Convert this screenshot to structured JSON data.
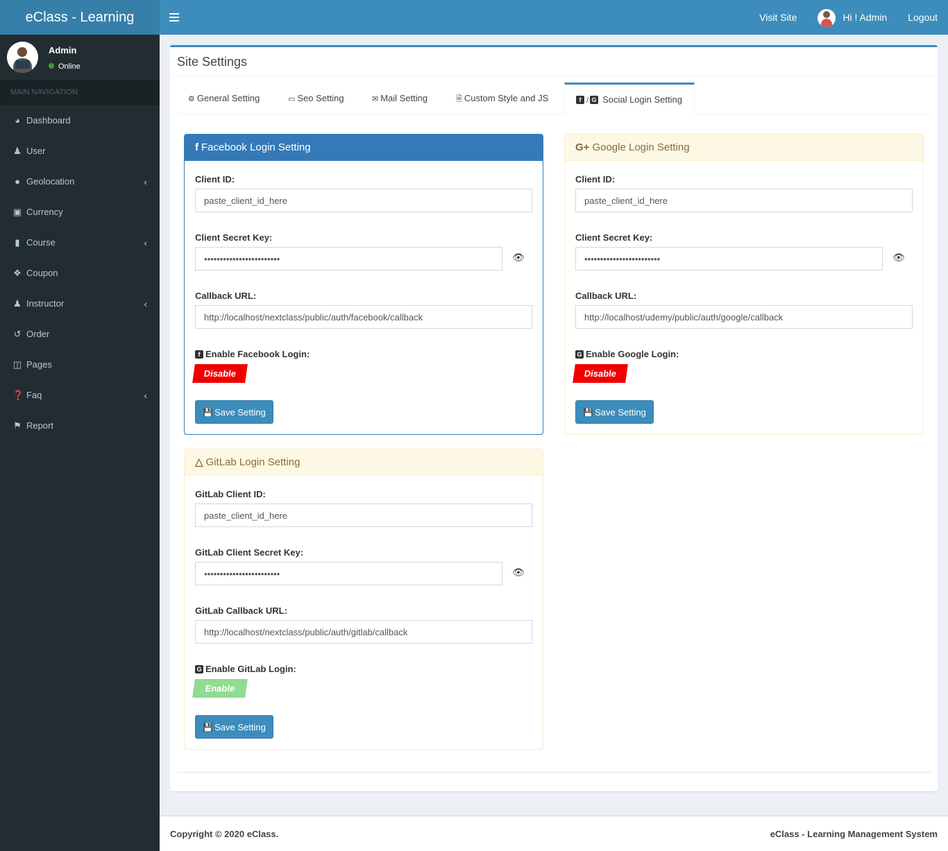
{
  "app": {
    "title": "eClass - Learning",
    "visit_site": "Visit Site",
    "greeting": "Hi ! Admin",
    "logout": "Logout"
  },
  "sidebar": {
    "user_name": "Admin",
    "user_status": "Online",
    "section_header": "MAIN NAVIGATION",
    "items": [
      {
        "label": "Dashboard",
        "icon": "dashboard-icon"
      },
      {
        "label": "User",
        "icon": "user-icon"
      },
      {
        "label": "Geolocation",
        "icon": "globe-icon"
      },
      {
        "label": "Currency",
        "icon": "money-icon"
      },
      {
        "label": "Course",
        "icon": "book-icon"
      },
      {
        "label": "Coupon",
        "icon": "tags-icon"
      },
      {
        "label": "Instructor",
        "icon": "user-plus-icon"
      },
      {
        "label": "Order",
        "icon": "history-icon"
      },
      {
        "label": "Pages",
        "icon": "columns-icon"
      },
      {
        "label": "Faq",
        "icon": "question-circle-icon"
      },
      {
        "label": "Report",
        "icon": "flag-icon"
      }
    ]
  },
  "page": {
    "title": "Site Settings",
    "tabs": [
      {
        "label": "General Setting",
        "icon": "gears-icon"
      },
      {
        "label": "Seo Setting",
        "icon": "laptop-icon"
      },
      {
        "label": "Mail Setting",
        "icon": "envelope-icon"
      },
      {
        "label": "Custom Style and JS",
        "icon": "file-code-icon"
      },
      {
        "label": "Social Login Setting",
        "icon": "facebook-google-icon",
        "active": true
      }
    ]
  },
  "facebook": {
    "heading": "Facebook Login Setting",
    "client_id_label": "Client ID:",
    "client_id_value": "paste_client_id_here",
    "secret_label": "Client Secret Key:",
    "secret_value": "••••••••••••••••••••••••",
    "callback_label": "Callback URL:",
    "callback_value": "http://localhost/nextclass/public/auth/facebook/callback",
    "enable_label": "Enable Facebook Login:",
    "toggle_label": "Disable",
    "save_label": "Save Setting"
  },
  "google": {
    "heading": "Google Login Setting",
    "client_id_label": "Client ID:",
    "client_id_value": "paste_client_id_here",
    "secret_label": "Client Secret Key:",
    "secret_value": "••••••••••••••••••••••••",
    "callback_label": "Callback URL:",
    "callback_value": "http://localhost/udemy/public/auth/google/callback",
    "enable_label": "Enable Google Login:",
    "toggle_label": "Disable",
    "save_label": "Save Setting"
  },
  "gitlab": {
    "heading": "GitLab Login Setting",
    "client_id_label": "GitLab Client ID:",
    "client_id_value": "paste_client_id_here",
    "secret_label": "GitLab Client Secret Key:",
    "secret_value": "••••••••••••••••••••••••",
    "callback_label": "GitLab Callback URL:",
    "callback_value": "http://localhost/nextclass/public/auth/gitlab/callback",
    "enable_label": "Enable GitLab Login:",
    "toggle_label": "Enable",
    "save_label": "Save Setting"
  },
  "footer": {
    "copyright": "Copyright © 2020 eClass.",
    "product": "eClass - Learning Management System"
  },
  "colors": {
    "primary": "#3c8dbc",
    "sidebar": "#222d32",
    "disable": "#f10000",
    "enable": "#90dc90"
  }
}
